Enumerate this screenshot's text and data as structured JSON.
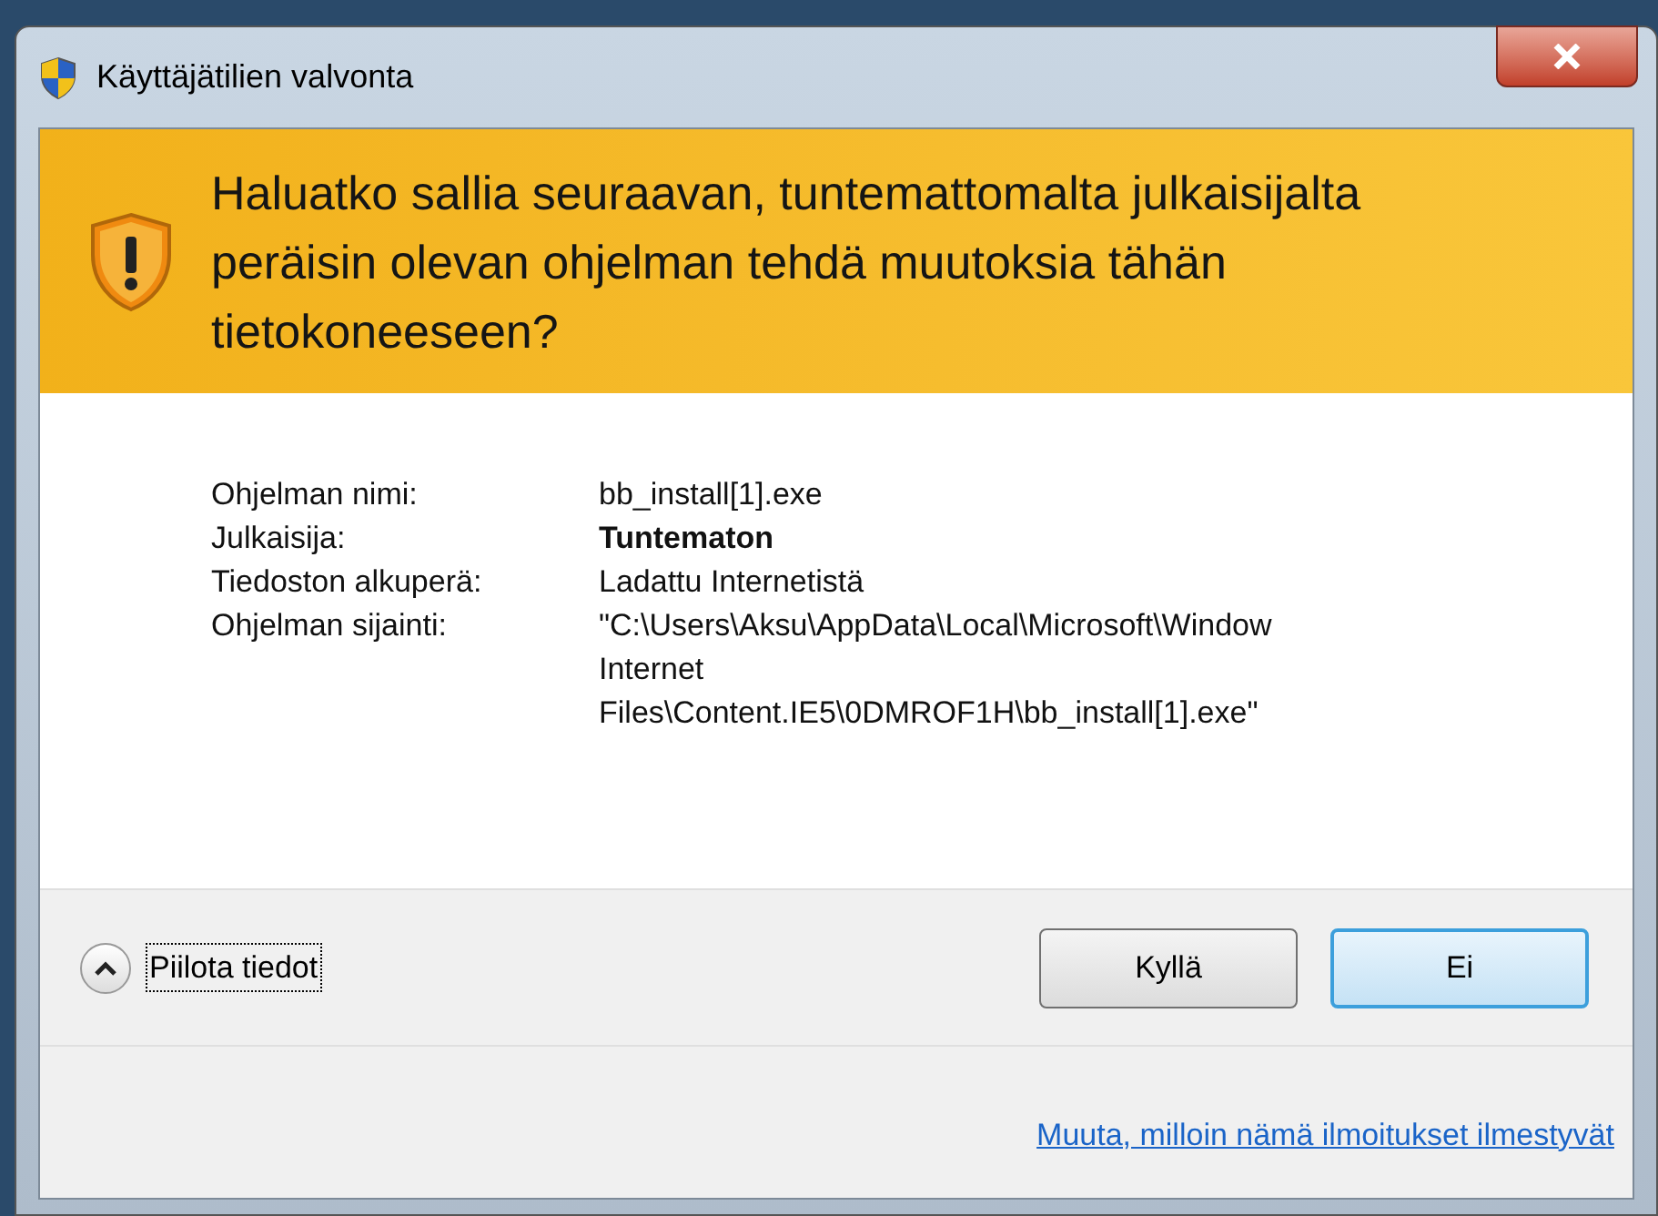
{
  "window": {
    "title": "Käyttäjätilien valvonta"
  },
  "banner": {
    "question": "Haluatko sallia seuraavan, tuntemattomalta julkaisijalta peräisin olevan ohjelman tehdä muutoksia tähän tietokoneeseen?"
  },
  "details": [
    {
      "label": "Ohjelman nimi:",
      "lines": [
        "bb_install[1].exe"
      ],
      "bold": false
    },
    {
      "label": "Julkaisija:",
      "lines": [
        "Tuntematon"
      ],
      "bold": true
    },
    {
      "label": "Tiedoston alkuperä:",
      "lines": [
        "Ladattu Internetistä"
      ],
      "bold": false
    },
    {
      "label": "Ohjelman sijainti:",
      "lines": [
        "\"C:\\Users\\Aksu\\AppData\\Local\\Microsoft\\Window",
        "Internet",
        "Files\\Content.IE5\\0DMROF1H\\bb_install[1].exe\""
      ],
      "bold": false
    }
  ],
  "toggle": {
    "label": "Piilota tiedot",
    "expanded": true
  },
  "buttons": [
    {
      "label": "Kyllä",
      "default": false
    },
    {
      "label": "Ei",
      "default": true
    }
  ],
  "settings_link": "Muuta, milloin nämä ilmoitukset ilmestyvät"
}
